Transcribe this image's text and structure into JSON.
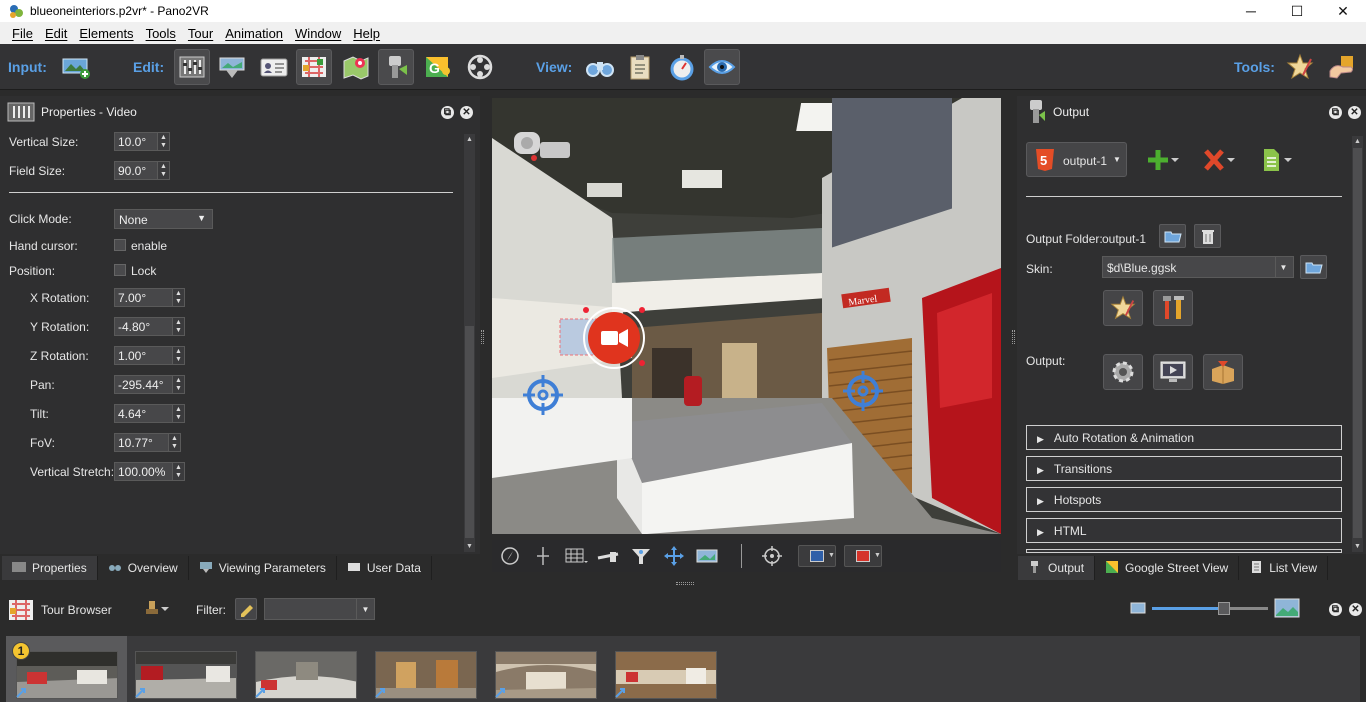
{
  "window": {
    "title": "blueoneinteriors.p2vr* - Pano2VR",
    "controls": {
      "minimize": "─",
      "maximize": "☐",
      "close": "✕"
    }
  },
  "menu": [
    "File",
    "Edit",
    "Elements",
    "Tools",
    "Tour",
    "Animation",
    "Window",
    "Help"
  ],
  "toolbar": {
    "input_label": "Input:",
    "edit_label": "Edit:",
    "view_label": "View:",
    "tools_label": "Tools:"
  },
  "properties": {
    "title": "Properties - Video",
    "vertical_size_label": "Vertical Size:",
    "vertical_size": "10.0°",
    "field_size_label": "Field Size:",
    "field_size": "90.0°",
    "click_mode_label": "Click Mode:",
    "click_mode": "None",
    "hand_cursor_label": "Hand cursor:",
    "hand_cursor_option": "enable",
    "position_label": "Position:",
    "position_option": "Lock",
    "x_rotation_label": "X Rotation:",
    "x_rotation": "7.00°",
    "y_rotation_label": "Y Rotation:",
    "y_rotation": "-4.80°",
    "z_rotation_label": "Z Rotation:",
    "z_rotation": "1.00°",
    "pan_label": "Pan:",
    "pan": "-295.44°",
    "tilt_label": "Tilt:",
    "tilt": "4.64°",
    "fov_label": "FoV:",
    "fov": "10.77°",
    "vstretch_label": "Vertical Stretch:",
    "vstretch": "100.00%"
  },
  "left_tabs": [
    "Properties",
    "Overview",
    "Viewing Parameters",
    "User Data"
  ],
  "output": {
    "title": "Output",
    "output_select": "output-1",
    "folder_label": "Output Folder:",
    "folder_value": "output-1",
    "skin_label": "Skin:",
    "skin_value": "$d\\Blue.ggsk",
    "output_label": "Output:",
    "sections": [
      "Auto Rotation & Animation",
      "Transitions",
      "Hotspots",
      "HTML"
    ]
  },
  "right_tabs": [
    "Output",
    "Google Street View",
    "List View"
  ],
  "tour": {
    "title": "Tour Browser",
    "filter_label": "Filter:",
    "filter_value": "",
    "first_badge": "1",
    "zoom_level": 0.62
  },
  "colors": {
    "accent": "#5aa0e6",
    "panel_bg": "#2f2f30",
    "hotspot_red": "#e0341e",
    "target_blue": "#3f7fd6"
  }
}
